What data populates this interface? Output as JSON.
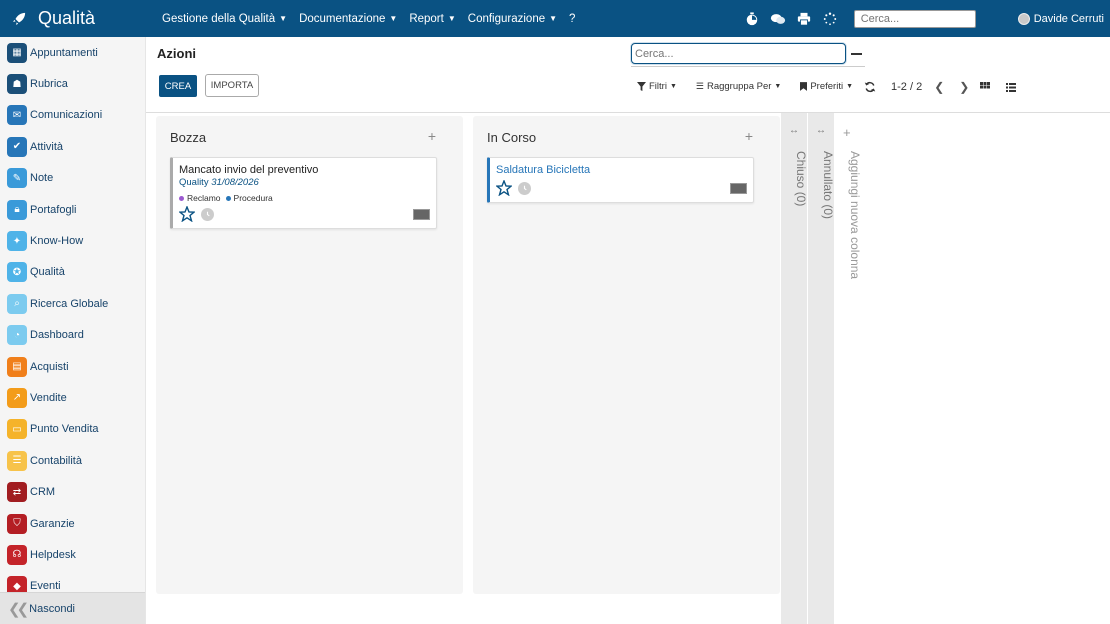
{
  "app": {
    "title": "Qualità",
    "menu": [
      {
        "label": "Gestione della Qualità",
        "caret": true
      },
      {
        "label": "Documentazione",
        "caret": true
      },
      {
        "label": "Report",
        "caret": true
      },
      {
        "label": "Configurazione",
        "caret": true
      },
      {
        "label": "?",
        "caret": false
      }
    ],
    "search_placeholder": "Cerca...",
    "user_name": "Davide Cerruti",
    "brand_color": "#0a5283"
  },
  "sidebar": {
    "items": [
      {
        "label": "Appuntamenti",
        "icon": "calendar-icon",
        "color": "#1b4f78"
      },
      {
        "label": "Rubrica",
        "icon": "contacts-icon",
        "color": "#1b4f78"
      },
      {
        "label": "Comunicazioni",
        "icon": "chat-icon",
        "color": "#2776b8"
      },
      {
        "label": "Attività",
        "icon": "check-icon",
        "color": "#2776b8"
      },
      {
        "label": "Note",
        "icon": "note-icon",
        "color": "#3a9ad9"
      },
      {
        "label": "Portafogli",
        "icon": "lock-icon",
        "color": "#3a9ad9"
      },
      {
        "label": "Know-How",
        "icon": "bulb-icon",
        "color": "#4fb3e8"
      },
      {
        "label": "Qualità",
        "icon": "quality-icon",
        "color": "#4fb3e8"
      },
      {
        "label": "Ricerca Globale",
        "icon": "search-icon",
        "color": "#7ccbef"
      },
      {
        "label": "Dashboard",
        "icon": "dashboard-icon",
        "color": "#7ccbef"
      },
      {
        "label": "Acquisti",
        "icon": "cart-icon",
        "color": "#f07f1b"
      },
      {
        "label": "Vendite",
        "icon": "chart-icon",
        "color": "#f39c1a"
      },
      {
        "label": "Punto Vendita",
        "icon": "pos-icon",
        "color": "#f5b32a"
      },
      {
        "label": "Contabilità",
        "icon": "accounting-icon",
        "color": "#f7c34a"
      },
      {
        "label": "CRM",
        "icon": "handshake-icon",
        "color": "#a11d21"
      },
      {
        "label": "Garanzie",
        "icon": "shield-icon",
        "color": "#b41e24"
      },
      {
        "label": "Helpdesk",
        "icon": "headset-icon",
        "color": "#c4242a"
      },
      {
        "label": "Eventi",
        "icon": "ticket-icon",
        "color": "#c4242a"
      }
    ],
    "footer_label": "Nascondi"
  },
  "control_panel": {
    "breadcrumb": "Azioni",
    "create_label": "CREA",
    "import_label": "IMPORTA",
    "search_placeholder": "Cerca...",
    "filters_label": "Filtri",
    "group_by_label": "Raggruppa Per",
    "favorites_label": "Preferiti",
    "pager_value": "1-2 / 2"
  },
  "kanban": {
    "columns": [
      {
        "title": "Bozza",
        "cards": [
          {
            "title": "Mancato invio del preventivo",
            "subtitle_label": "Quality",
            "subtitle_date": "31/08/2026",
            "tags": [
              {
                "label": "Reclamo",
                "color": "#9b59d0"
              },
              {
                "label": "Procedura",
                "color": "#2776b8"
              }
            ],
            "border_color": "#aaaaaa"
          }
        ]
      },
      {
        "title": "In Corso",
        "cards": [
          {
            "title": "Saldatura Bicicletta",
            "border_color": "#2776b8"
          }
        ]
      }
    ],
    "folded": [
      {
        "title": "Chiuso (0)"
      },
      {
        "title": "Annullato (0)"
      }
    ],
    "add_column_label": "Aggiungi nuova colonna"
  }
}
